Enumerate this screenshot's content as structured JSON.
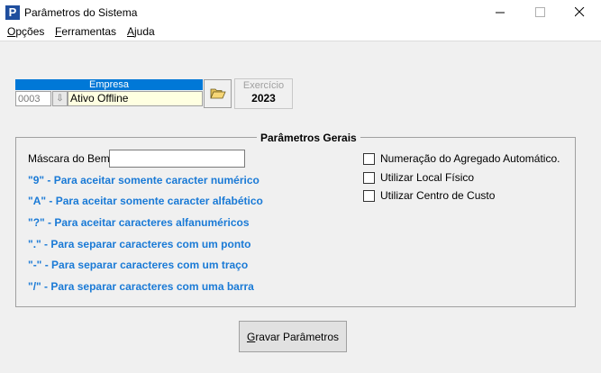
{
  "window": {
    "title": "Parâmetros do Sistema",
    "icon_letter": "P"
  },
  "menu": [
    {
      "underline": "O",
      "rest": "pções"
    },
    {
      "underline": "F",
      "rest": "erramentas"
    },
    {
      "underline": "A",
      "rest": "juda"
    }
  ],
  "empresa": {
    "header": "Empresa",
    "code": "0003",
    "name": "Ativo Offline"
  },
  "exercicio": {
    "label": "Exercício",
    "year": "2023"
  },
  "params": {
    "group_title": "Parâmetros Gerais",
    "mask_label": "Máscara do Bem",
    "mask_value": "",
    "hints": [
      "\"9\" - Para aceitar somente caracter numérico",
      "\"A\" - Para aceitar somente caracter alfabético",
      "\"?\" - Para aceitar caracteres alfanuméricos",
      "\".\" - Para separar caracteres com um ponto",
      "\"-\" - Para separar caracteres com um traço",
      "\"/\" - Para separar caracteres com uma barra"
    ],
    "checkboxes": [
      {
        "label": "Numeração do Agregado Automático.",
        "checked": false
      },
      {
        "label": "Utilizar Local Físico",
        "checked": false
      },
      {
        "label": "Utilizar Centro de Custo",
        "checked": false
      }
    ]
  },
  "save_button": {
    "underline": "G",
    "rest": "ravar Parâmetros"
  },
  "colors": {
    "hint_text": "#1a7ad6",
    "header_bg": "#0078d7",
    "readonly_bg": "#ffffe1"
  }
}
